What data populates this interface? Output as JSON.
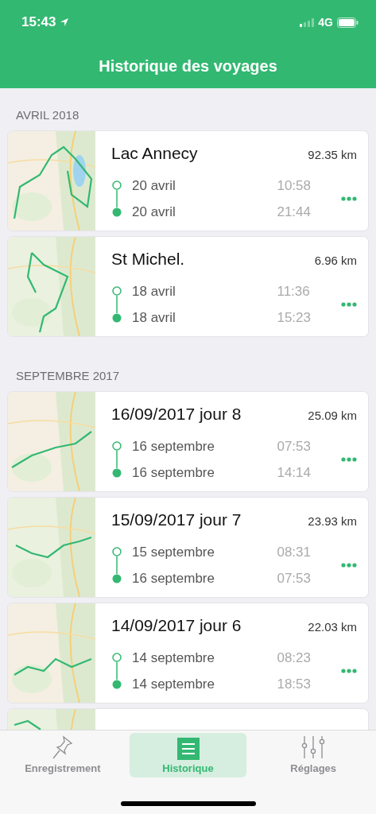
{
  "status_bar": {
    "time": "15:43",
    "network": "4G"
  },
  "header": {
    "title": "Historique des voyages"
  },
  "sections": [
    {
      "title": "AVRIL 2018",
      "trips": [
        {
          "map": {
            "kind": "picture"
          },
          "title": "Lac Annecy",
          "distance": "92.35 km",
          "start": {
            "date": "20 avril",
            "time": "10:58"
          },
          "end": {
            "date": "20 avril",
            "time": "21:44"
          }
        },
        {
          "map": {
            "kind": "picture"
          },
          "title": "St Michel.",
          "distance": "6.96 km",
          "start": {
            "date": "18 avril",
            "time": "11:36"
          },
          "end": {
            "date": "18 avril",
            "time": "15:23"
          }
        }
      ]
    },
    {
      "title": "SEPTEMBRE 2017",
      "trips": [
        {
          "map": {
            "kind": "picture"
          },
          "title": "16/09/2017 jour 8",
          "distance": "25.09 km",
          "start": {
            "date": "16 septembre",
            "time": "07:53"
          },
          "end": {
            "date": "16 septembre",
            "time": "14:14"
          }
        },
        {
          "map": {
            "kind": "picture"
          },
          "title": "15/09/2017 jour 7",
          "distance": "23.93 km",
          "start": {
            "date": "15 septembre",
            "time": "08:31"
          },
          "end": {
            "date": "16 septembre",
            "time": "07:53"
          }
        },
        {
          "map": {
            "kind": "picture"
          },
          "title": "14/09/2017 jour 6",
          "distance": "22.03 km",
          "start": {
            "date": "14 septembre",
            "time": "08:23"
          },
          "end": {
            "date": "14 septembre",
            "time": "18:53"
          }
        },
        {
          "map": {
            "kind": "picture"
          }
        }
      ]
    }
  ],
  "tabs": [
    {
      "kind": "pin",
      "label": "Enregistrement",
      "selected": false
    },
    {
      "kind": "list",
      "label": "Historique",
      "selected": true
    },
    {
      "kind": "sliders",
      "label": "Réglages",
      "selected": false
    }
  ]
}
